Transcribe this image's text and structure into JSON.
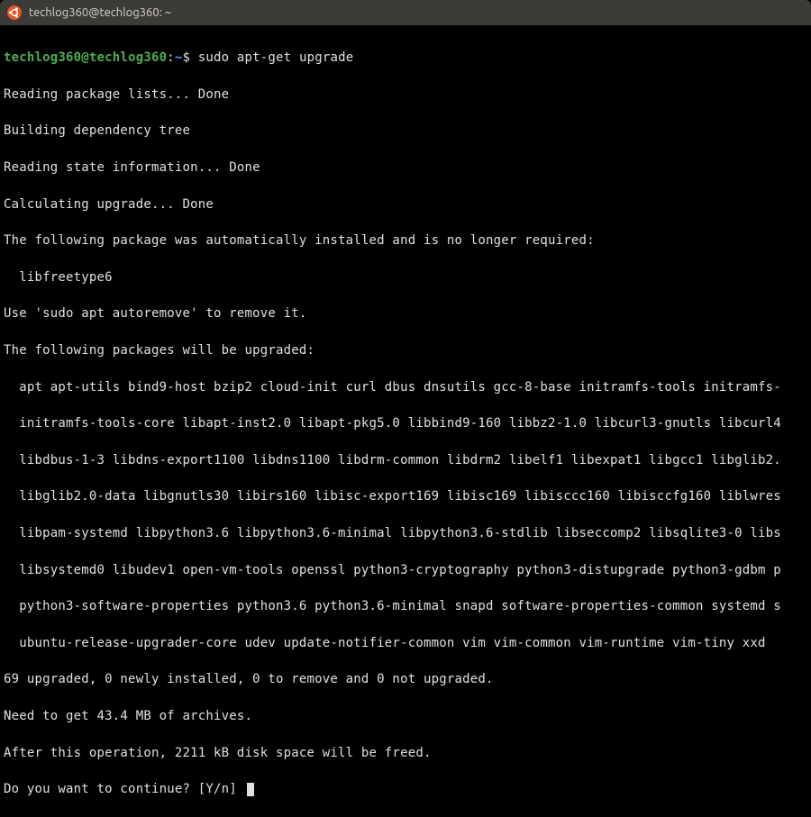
{
  "window": {
    "title": "techlog360@techlog360: ~"
  },
  "prompt": {
    "user_host": "techlog360@techlog360",
    "separator": ":",
    "path": "~",
    "symbol": "$"
  },
  "command": "sudo apt-get upgrade",
  "output": {
    "l01": "Reading package lists... Done",
    "l02": "Building dependency tree",
    "l03": "Reading state information... Done",
    "l04": "Calculating upgrade... Done",
    "l05": "The following package was automatically installed and is no longer required:",
    "l06": "  libfreetype6",
    "l07": "Use 'sudo apt autoremove' to remove it.",
    "l08": "The following packages will be upgraded:",
    "l09": "  apt apt-utils bind9-host bzip2 cloud-init curl dbus dnsutils gcc-8-base initramfs-tools initramfs-",
    "l10": "  initramfs-tools-core libapt-inst2.0 libapt-pkg5.0 libbind9-160 libbz2-1.0 libcurl3-gnutls libcurl4",
    "l11": "  libdbus-1-3 libdns-export1100 libdns1100 libdrm-common libdrm2 libelf1 libexpat1 libgcc1 libglib2.",
    "l12": "  libglib2.0-data libgnutls30 libirs160 libisc-export169 libisc169 libisccc160 libisccfg160 liblwres",
    "l13": "  libpam-systemd libpython3.6 libpython3.6-minimal libpython3.6-stdlib libseccomp2 libsqlite3-0 libs",
    "l14": "  libsystemd0 libudev1 open-vm-tools openssl python3-cryptography python3-distupgrade python3-gdbm p",
    "l15": "  python3-software-properties python3.6 python3.6-minimal snapd software-properties-common systemd s",
    "l16": "  ubuntu-release-upgrader-core udev update-notifier-common vim vim-common vim-runtime vim-tiny xxd",
    "l17": "69 upgraded, 0 newly installed, 0 to remove and 0 not upgraded.",
    "l18": "Need to get 43.4 MB of archives.",
    "l19": "After this operation, 2211 kB disk space will be freed.",
    "l20": "Do you want to continue? [Y/n] "
  }
}
